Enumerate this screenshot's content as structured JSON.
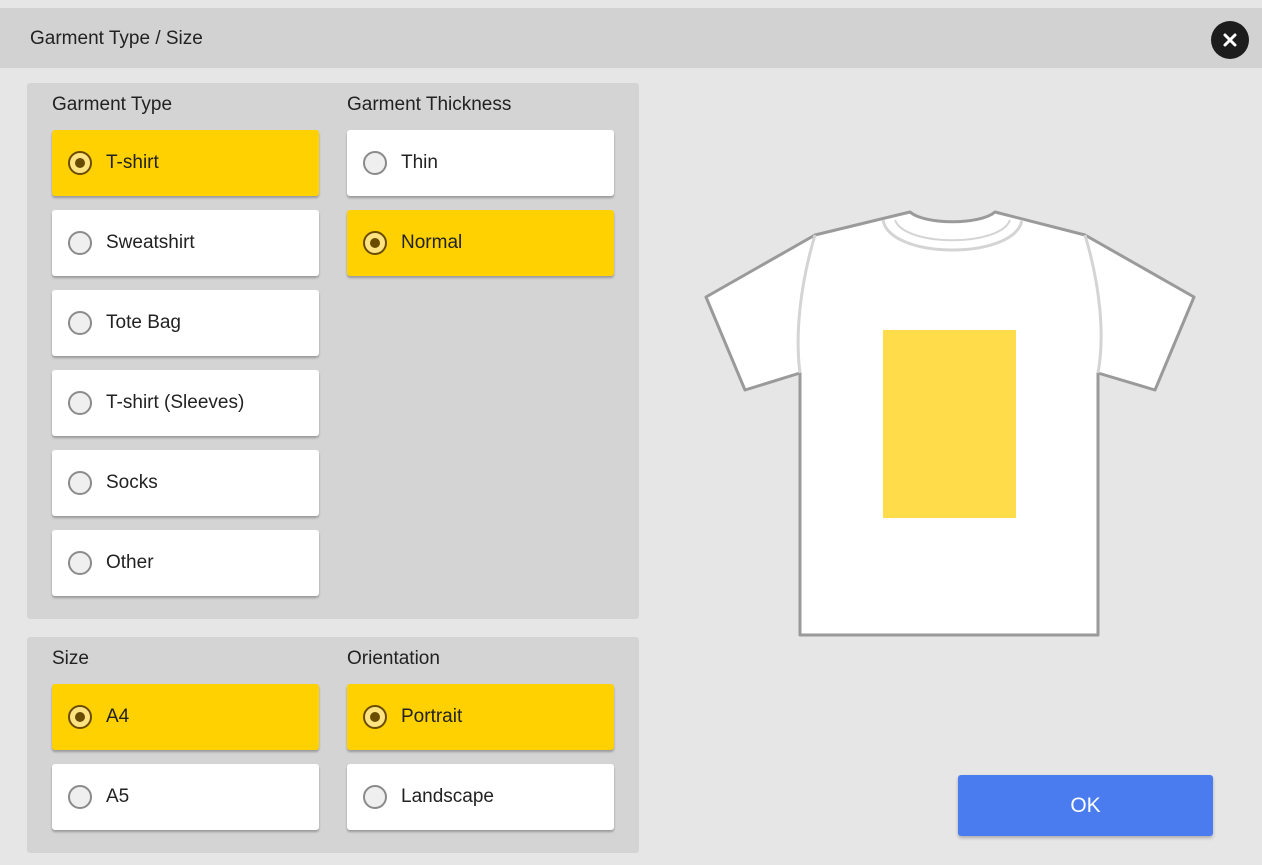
{
  "dialog": {
    "title": "Garment Type / Size",
    "close_icon": "close-icon"
  },
  "garment_type": {
    "label": "Garment Type",
    "options": [
      {
        "label": "T-shirt",
        "selected": true
      },
      {
        "label": "Sweatshirt",
        "selected": false
      },
      {
        "label": "Tote Bag",
        "selected": false
      },
      {
        "label": "T-shirt (Sleeves)",
        "selected": false
      },
      {
        "label": "Socks",
        "selected": false
      },
      {
        "label": "Other",
        "selected": false
      }
    ]
  },
  "garment_thickness": {
    "label": "Garment Thickness",
    "options": [
      {
        "label": "Thin",
        "selected": false
      },
      {
        "label": "Normal",
        "selected": true
      }
    ]
  },
  "size": {
    "label": "Size",
    "options": [
      {
        "label": "A4",
        "selected": true
      },
      {
        "label": "A5",
        "selected": false
      }
    ]
  },
  "orientation": {
    "label": "Orientation",
    "options": [
      {
        "label": "Portrait",
        "selected": true
      },
      {
        "label": "Landscape",
        "selected": false
      }
    ]
  },
  "preview": {
    "icon": "tshirt-preview",
    "print_area_color": "#ffdd4a"
  },
  "ok_label": "OK",
  "colors": {
    "selected": "#ffd100",
    "ok_button": "#4a7cf0",
    "panel": "#d4d4d4",
    "background": "#e6e6e6"
  }
}
